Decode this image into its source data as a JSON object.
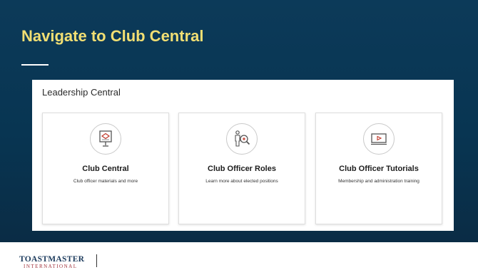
{
  "slide": {
    "title": "Navigate to Club Central"
  },
  "panel": {
    "heading": "Leadership Central",
    "cards": [
      {
        "title": "Club Central",
        "description": "Club officer materials and more",
        "icon": "presentation-board-icon"
      },
      {
        "title": "Club Officer Roles",
        "description": "Learn more about elected positions",
        "icon": "person-magnifier-icon"
      },
      {
        "title": "Club Officer Tutorials",
        "description": "Membership and administration training",
        "icon": "video-play-icon"
      }
    ]
  },
  "footer": {
    "logo_main": "TOASTMASTERS",
    "logo_sub": "INTERNATIONAL"
  },
  "colors": {
    "background": "#0a3756",
    "title": "#f2df73",
    "brand": "#1b3a5c"
  }
}
